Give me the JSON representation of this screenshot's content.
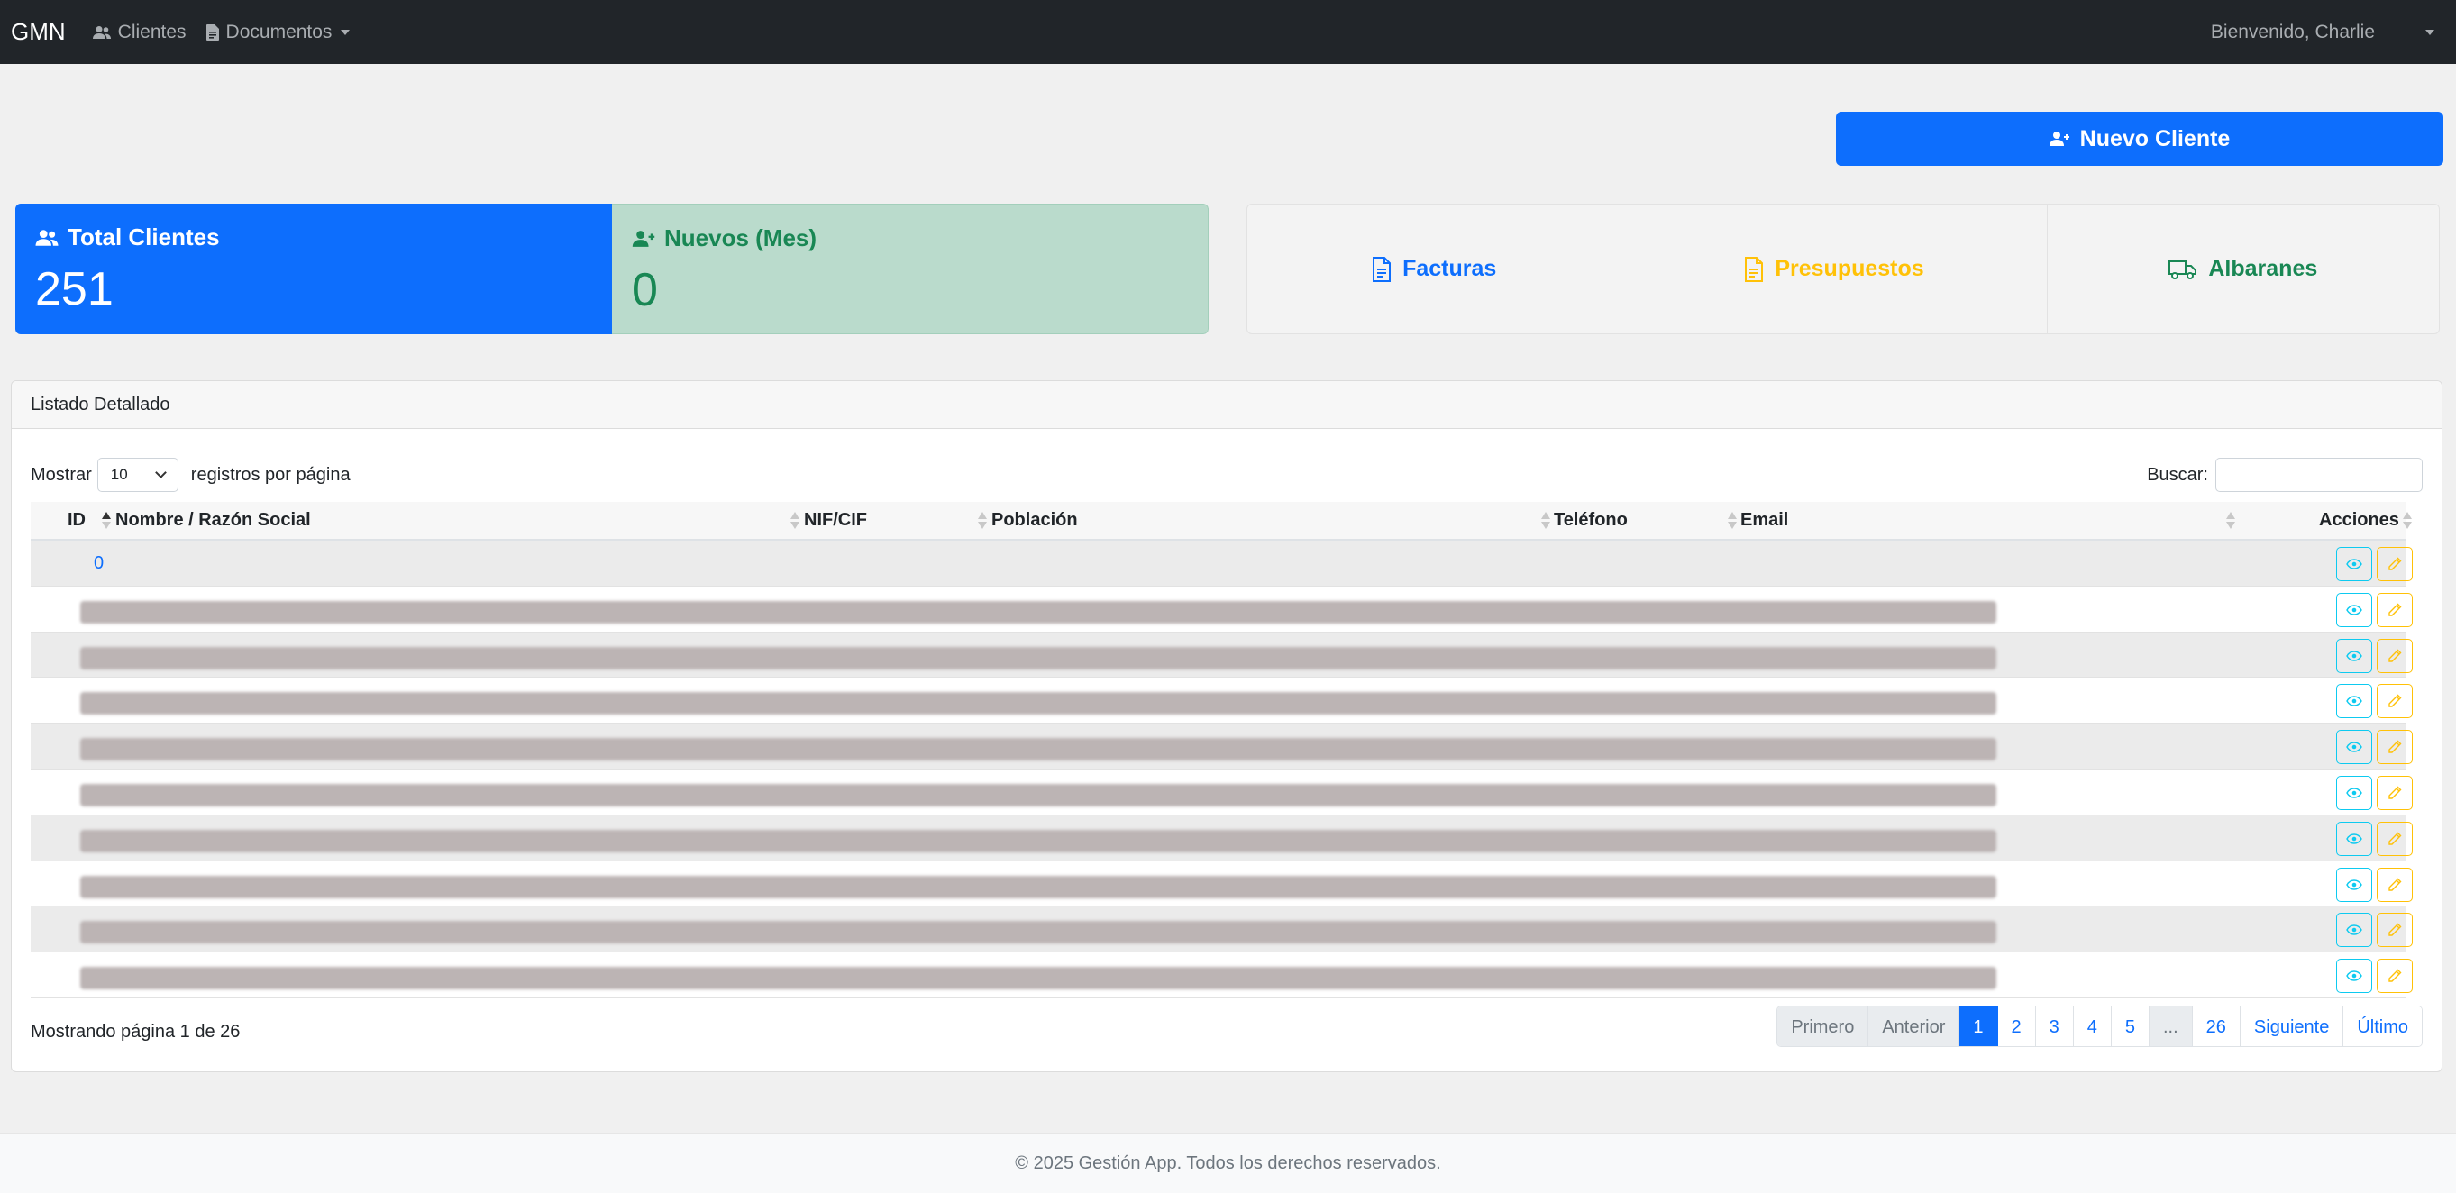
{
  "navbar": {
    "brand": "GMN",
    "clients": "Clientes",
    "documents": "Documentos",
    "user": "Bienvenido, Charlie"
  },
  "actions": {
    "new_client": "Nuevo Cliente"
  },
  "stats": {
    "total_label": "Total Clientes",
    "total_value": "251",
    "new_label": "Nuevos (Mes)",
    "new_value": "0"
  },
  "docs": {
    "facturas": "Facturas",
    "presupuestos": "Presupuestos",
    "albaranes": "Albaranes"
  },
  "list": {
    "header": "Listado Detallado",
    "show_label": "Mostrar",
    "page_size": "10",
    "per_page_label": "registros por página",
    "search_label": "Buscar:",
    "search_value": "",
    "columns": {
      "id": "ID",
      "name": "Nombre / Razón Social",
      "nif": "NIF/CIF",
      "population": "Población",
      "phone": "Teléfono",
      "email": "Email",
      "actions": "Acciones"
    },
    "first_row_id": "0",
    "showing": "Mostrando página 1 de 26"
  },
  "pagination": {
    "first": "Primero",
    "prev": "Anterior",
    "p1": "1",
    "p2": "2",
    "p3": "3",
    "p4": "4",
    "p5": "5",
    "ellipsis": "...",
    "p26": "26",
    "next": "Siguiente",
    "last": "Último"
  },
  "footer": {
    "text": "© 2025 Gestión App. Todos los derechos reservados."
  },
  "colors": {
    "primary": "#0d6efd",
    "success": "#198754",
    "warning": "#ffc107",
    "info": "#0dcaf0",
    "navbar": "#212529"
  }
}
